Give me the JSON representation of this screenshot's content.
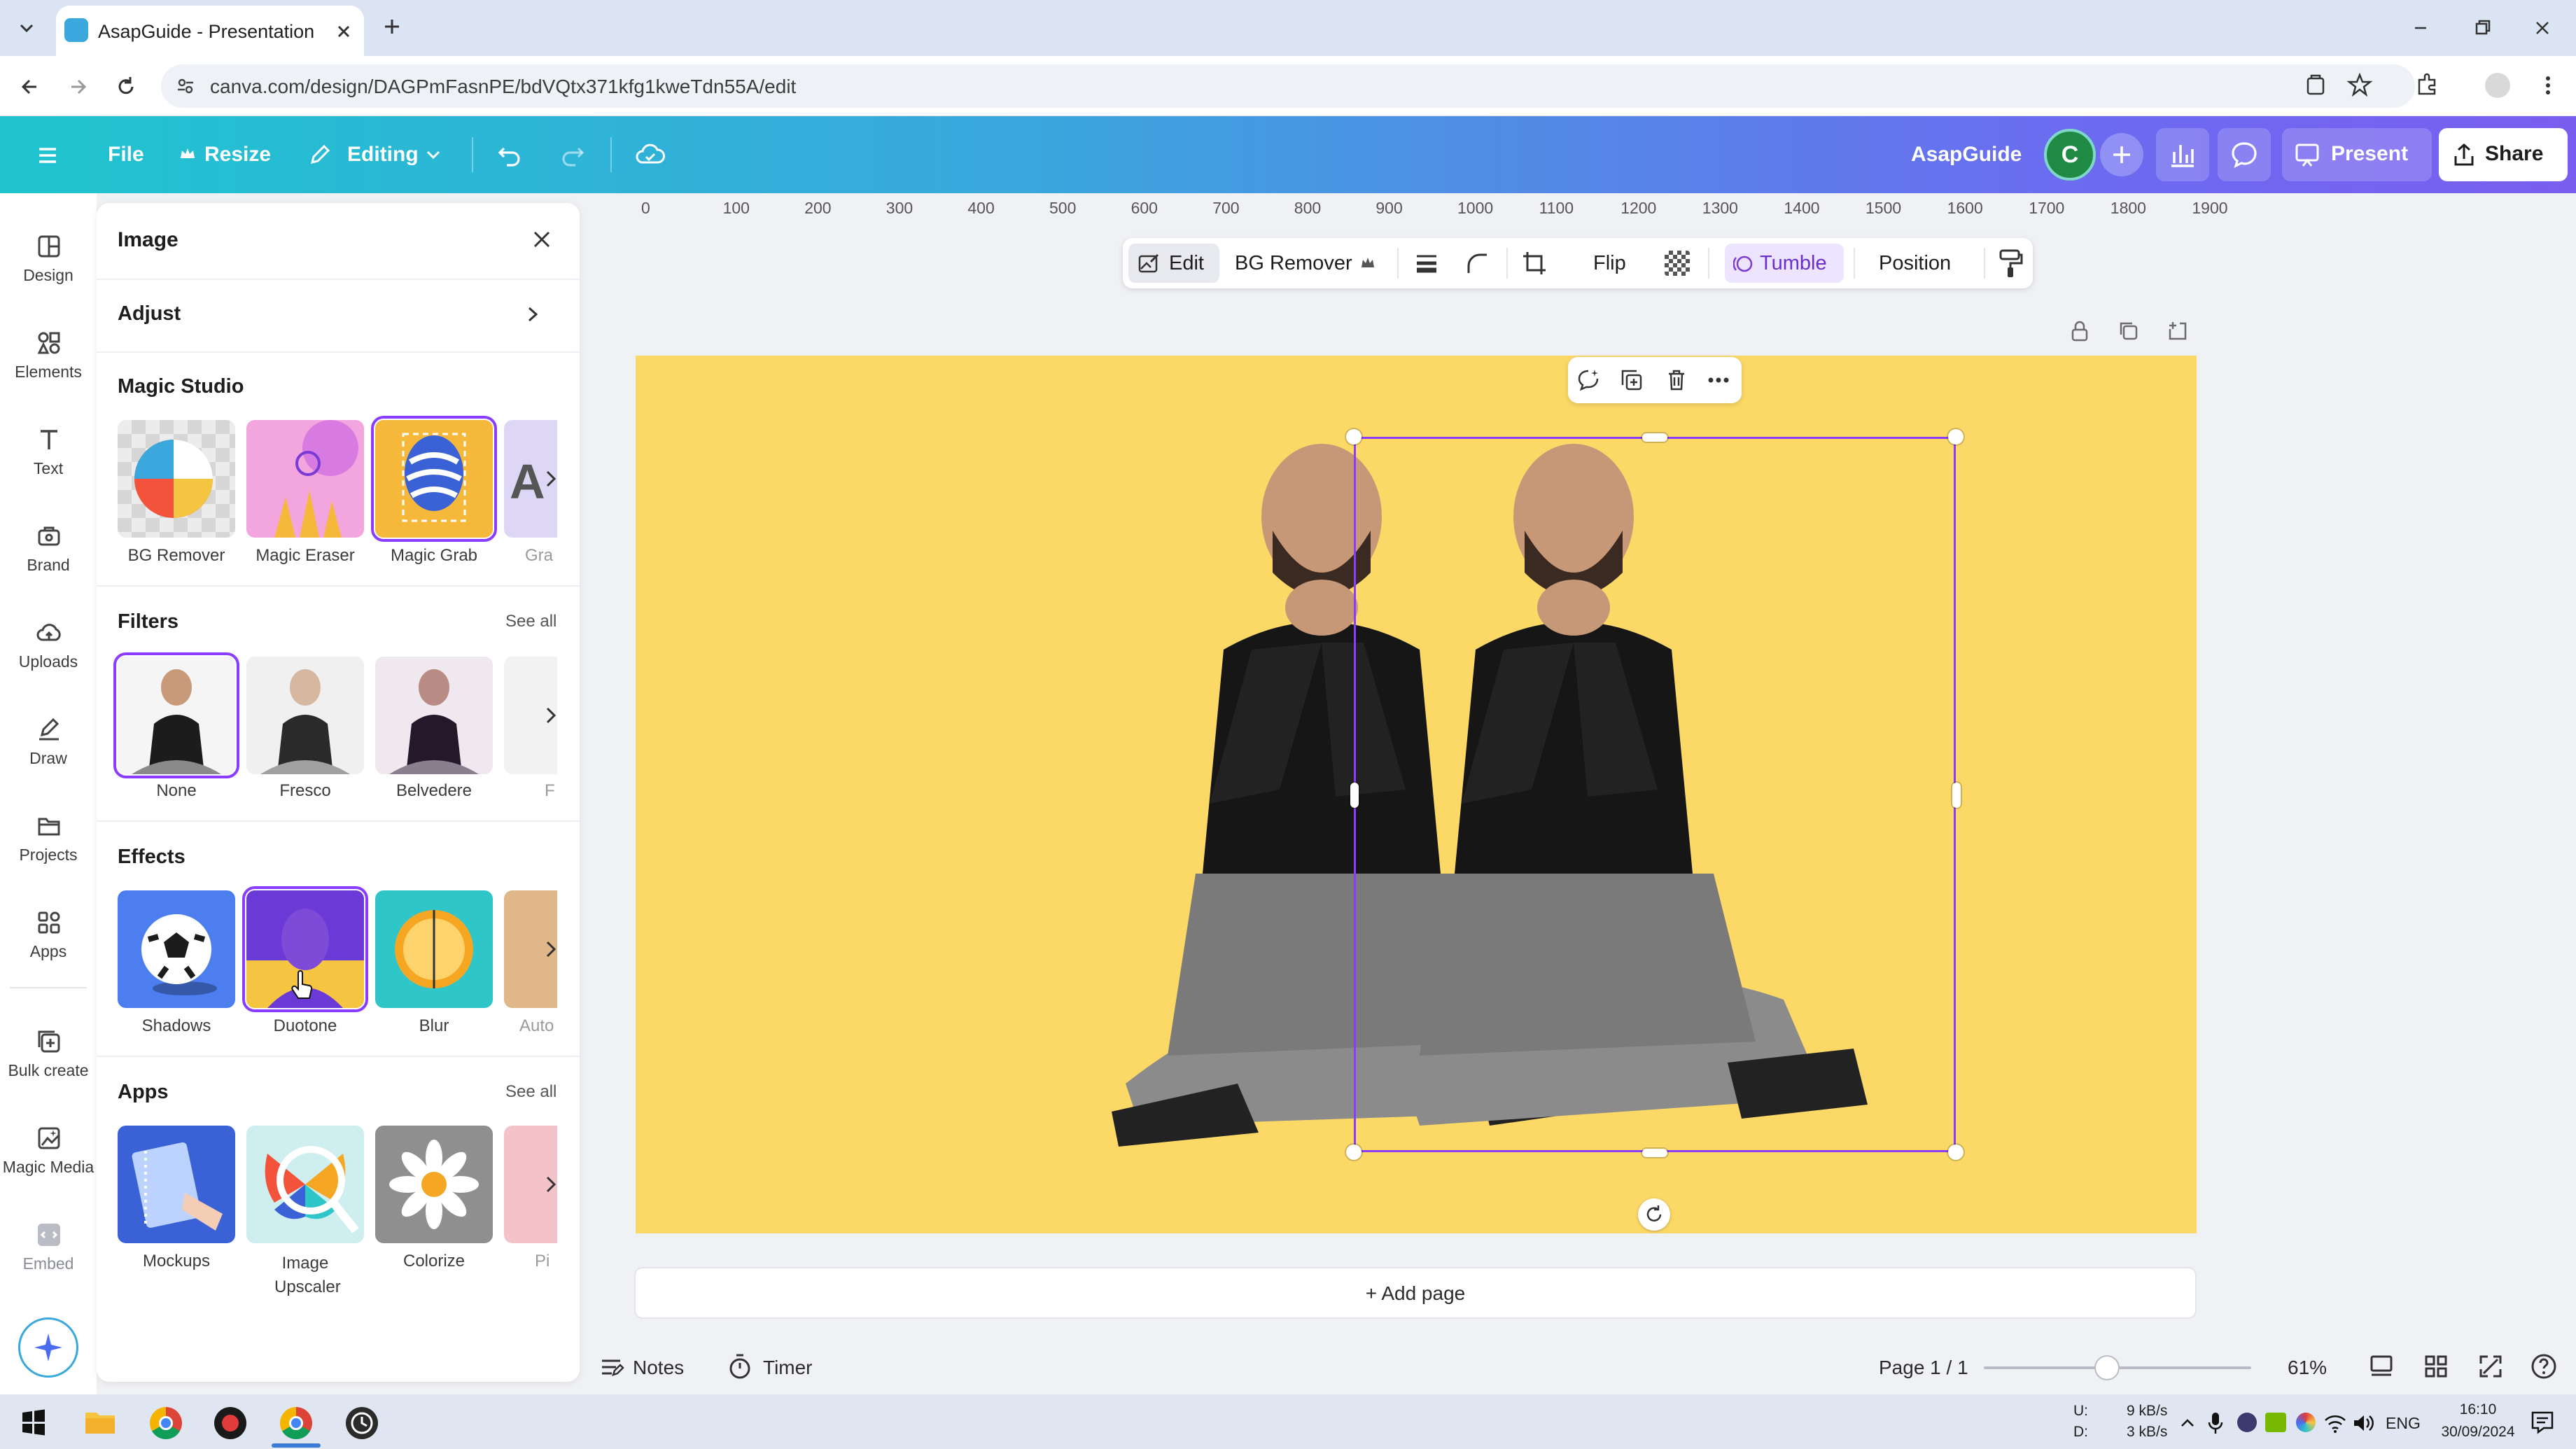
{
  "browser": {
    "tab_title": "AsapGuide - Presentation",
    "url": "canva.com/design/DAGPmFasnPE/bdVQtx371kfg1kweTdn55A/edit"
  },
  "topbar": {
    "file": "File",
    "resize": "Resize",
    "editing": "Editing",
    "team_name": "AsapGuide",
    "avatar_letter": "C",
    "present": "Present",
    "share": "Share"
  },
  "rail": {
    "items": [
      "Design",
      "Elements",
      "Text",
      "Brand",
      "Uploads",
      "Draw",
      "Projects",
      "Apps",
      "Bulk create",
      "Magic Media",
      "Embed"
    ]
  },
  "panel": {
    "title": "Image",
    "adjust": "Adjust",
    "magic_studio": {
      "heading": "Magic Studio",
      "items": [
        "BG Remover",
        "Magic Eraser",
        "Magic Grab",
        "Gra"
      ]
    },
    "filters": {
      "heading": "Filters",
      "see_all": "See all",
      "items": [
        "None",
        "Fresco",
        "Belvedere",
        "F"
      ]
    },
    "effects": {
      "heading": "Effects",
      "items": [
        "Shadows",
        "Duotone",
        "Blur",
        "Auto"
      ]
    },
    "apps": {
      "heading": "Apps",
      "see_all": "See all",
      "items": [
        "Mockups",
        "Image Upscaler",
        "Colorize",
        "Pi"
      ]
    }
  },
  "ruler": [
    "0",
    "100",
    "200",
    "300",
    "400",
    "500",
    "600",
    "700",
    "800",
    "900",
    "1000",
    "1100",
    "1200",
    "1300",
    "1400",
    "1500",
    "1600",
    "1700",
    "1800",
    "1900"
  ],
  "context_toolbar": {
    "edit": "Edit",
    "bg_remover": "BG Remover",
    "flip": "Flip",
    "tumble": "Tumble",
    "position": "Position"
  },
  "canvas": {
    "add_page": "+ Add page",
    "background_color": "#fcd967",
    "selection_color": "#8b3dff"
  },
  "bottombar": {
    "notes": "Notes",
    "timer": "Timer",
    "page": "Page 1 / 1",
    "zoom": "61%",
    "zoom_fraction": 0.61
  },
  "taskbar": {
    "net_up": "9 kB/s",
    "net_down": "3 kB/s",
    "net_u": "U:",
    "net_d": "D:",
    "lang": "ENG",
    "time": "16:10",
    "date": "30/09/2024"
  }
}
